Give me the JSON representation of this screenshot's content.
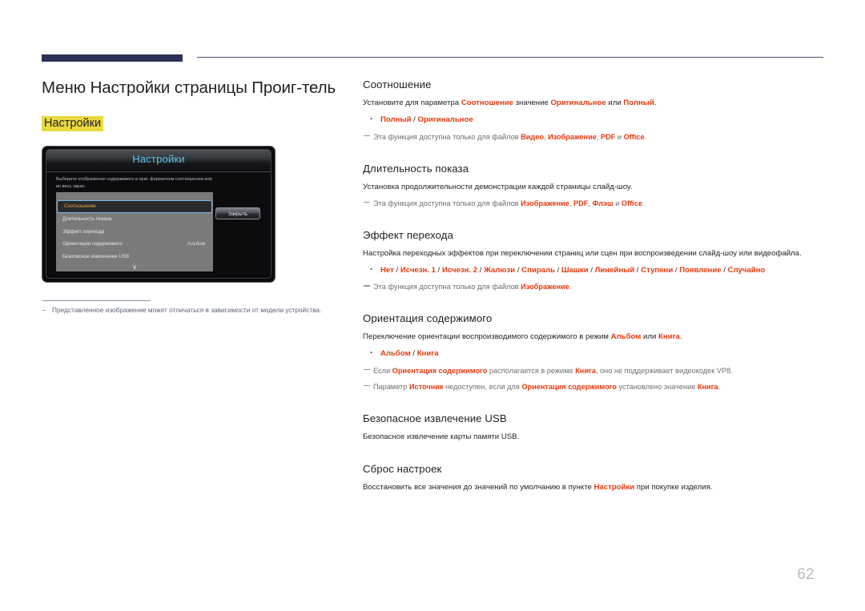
{
  "page": {
    "title": "Меню Настройки страницы Проиг-тель",
    "highlight_label": "Настройки",
    "number": "62",
    "accent_red": "#e8380d",
    "highlight_yellow": "#e7d93f",
    "header_bar_color": "#2b3255"
  },
  "figure": {
    "tv_menu": {
      "title": "Настройки",
      "description": "Выберите отображение содержимого в ориг. форматном соотношении или во весь экран.",
      "rows": [
        {
          "label": "Соотношение",
          "value": "",
          "selected": true
        },
        {
          "label": "Длительность показа",
          "value": "",
          "selected": false
        },
        {
          "label": "Эффект перехода",
          "value": "",
          "selected": false
        },
        {
          "label": "Ориентация содержимого",
          "value": "Альбом",
          "selected": false
        },
        {
          "label": "Безопасное извлечение USB",
          "value": "",
          "selected": false
        }
      ],
      "scroll_icon": "chevron-down-icon",
      "close_button": "Закрыть"
    },
    "footnote_dash": "–",
    "footnote": "Представленное изображение может отличаться в зависимости от модели устройства."
  },
  "sections": [
    {
      "heading": "Соотношение",
      "para_parts": [
        {
          "t": "Установите для параметра ",
          "r": false
        },
        {
          "t": "Соотношение",
          "r": true
        },
        {
          "t": " значение ",
          "r": false
        },
        {
          "t": "Оригинальное",
          "r": true
        },
        {
          "t": " или ",
          "r": false
        },
        {
          "t": "Полный",
          "r": true
        },
        {
          "t": ".",
          "r": false
        }
      ],
      "options": "Полный / Оригинальное",
      "notes": [
        [
          {
            "t": "Эта функция доступна только для файлов ",
            "r": false
          },
          {
            "t": "Видео",
            "r": true
          },
          {
            "t": ", ",
            "r": false
          },
          {
            "t": "Изображение",
            "r": true
          },
          {
            "t": ", ",
            "r": false
          },
          {
            "t": "PDF",
            "r": true
          },
          {
            "t": " и ",
            "r": false
          },
          {
            "t": "Office",
            "r": true
          },
          {
            "t": ".",
            "r": false
          }
        ]
      ]
    },
    {
      "heading": "Длительность показа",
      "para_parts": [
        {
          "t": "Установка продолжительности демонстрации каждой страницы слайд-шоу.",
          "r": false
        }
      ],
      "options": "",
      "notes": [
        [
          {
            "t": "Эта функция доступна только для файлов ",
            "r": false
          },
          {
            "t": "Изображение",
            "r": true
          },
          {
            "t": ", ",
            "r": false
          },
          {
            "t": "PDF",
            "r": true
          },
          {
            "t": ", ",
            "r": false
          },
          {
            "t": "Флэш",
            "r": true
          },
          {
            "t": " и ",
            "r": false
          },
          {
            "t": "Office",
            "r": true
          },
          {
            "t": ".",
            "r": false
          }
        ]
      ]
    },
    {
      "heading": "Эффект перехода",
      "para_parts": [
        {
          "t": "Настройка переходных эффектов при переключении страниц или сцен при воспроизведении слайд-шоу или видеофайла.",
          "r": false
        }
      ],
      "options": "Нет / Исчезн. 1 / Исчезн. 2 / Жалюзи / Спираль / Шашки / Линейный / Ступени / Появление / Случайно",
      "notes": [
        [
          {
            "t": "Эта функция доступна только для файлов ",
            "r": false
          },
          {
            "t": "Изображение",
            "r": true
          },
          {
            "t": ".",
            "r": false
          }
        ]
      ]
    },
    {
      "heading": "Ориентация содержимого",
      "para_parts": [
        {
          "t": "Переключение ориентации воспроизводимого содержимого в режим ",
          "r": false
        },
        {
          "t": "Альбом",
          "r": true
        },
        {
          "t": " или ",
          "r": false
        },
        {
          "t": "Книга",
          "r": true
        },
        {
          "t": ".",
          "r": false
        }
      ],
      "options": "Альбом / Книга",
      "notes": [
        [
          {
            "t": "Если ",
            "r": false
          },
          {
            "t": "Ориентация содержимого",
            "r": true
          },
          {
            "t": " располагается в режиме ",
            "r": false
          },
          {
            "t": "Книга",
            "r": true
          },
          {
            "t": ", оно не поддерживает видеокодек VP8.",
            "r": false
          }
        ],
        [
          {
            "t": "Параметр ",
            "r": false
          },
          {
            "t": "Источник",
            "r": true
          },
          {
            "t": " недоступен, если для ",
            "r": false
          },
          {
            "t": "Ориентация содержимого",
            "r": true
          },
          {
            "t": " установлено значение ",
            "r": false
          },
          {
            "t": "Книга",
            "r": true
          },
          {
            "t": ".",
            "r": false
          }
        ]
      ]
    },
    {
      "heading": "Безопасное извлечение USB",
      "para_parts": [
        {
          "t": "Безопасное извлечение карты памяти USB.",
          "r": false
        }
      ],
      "options": "",
      "notes": []
    },
    {
      "heading": "Сброс настроек",
      "para_parts": [
        {
          "t": "Восстановить все значения до значений по умолчанию в пункте ",
          "r": false
        },
        {
          "t": "Настройки",
          "r": true
        },
        {
          "t": " при покупке изделия.",
          "r": false
        }
      ],
      "options": "",
      "notes": []
    }
  ]
}
